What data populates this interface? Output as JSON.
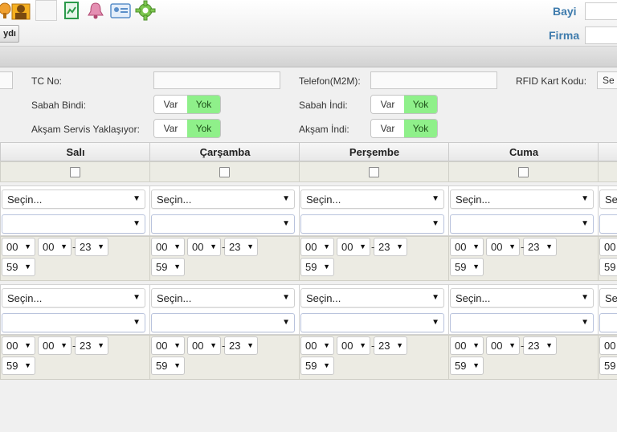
{
  "header": {
    "bayi_label": "Bayi",
    "firma_label": "Firma",
    "save_label": "ydı"
  },
  "form": {
    "tc_label": "TC No:",
    "telefon_label": "Telefon(M2M):",
    "rfid_label": "RFID Kart Kodu:",
    "rfid_value": "Se",
    "sabah_bindi_label": "Sabah Bindi:",
    "sabah_indi_label": "Sabah İndi:",
    "aksam_servis_label": "Akşam Servis Yaklaşıyor:",
    "aksam_indi_label": "Akşam İndi:",
    "var": "Var",
    "yok": "Yok"
  },
  "days": [
    "Salı",
    "Çarşamba",
    "Perşembe",
    "Cuma"
  ],
  "select_placeholder": "Seçin...",
  "partial_select": "Se",
  "times": {
    "h1": "00",
    "m1": "00",
    "h2": "23",
    "m2": "59"
  },
  "colors": {
    "toggle_on": "#8ff08a",
    "label_blue": "#3f7cad",
    "grid_bg": "#ecebe3"
  },
  "icons": [
    "pin-icon",
    "user-icon",
    "blank-icon",
    "report-icon",
    "bell-icon",
    "id-card-icon",
    "gear-icon"
  ]
}
